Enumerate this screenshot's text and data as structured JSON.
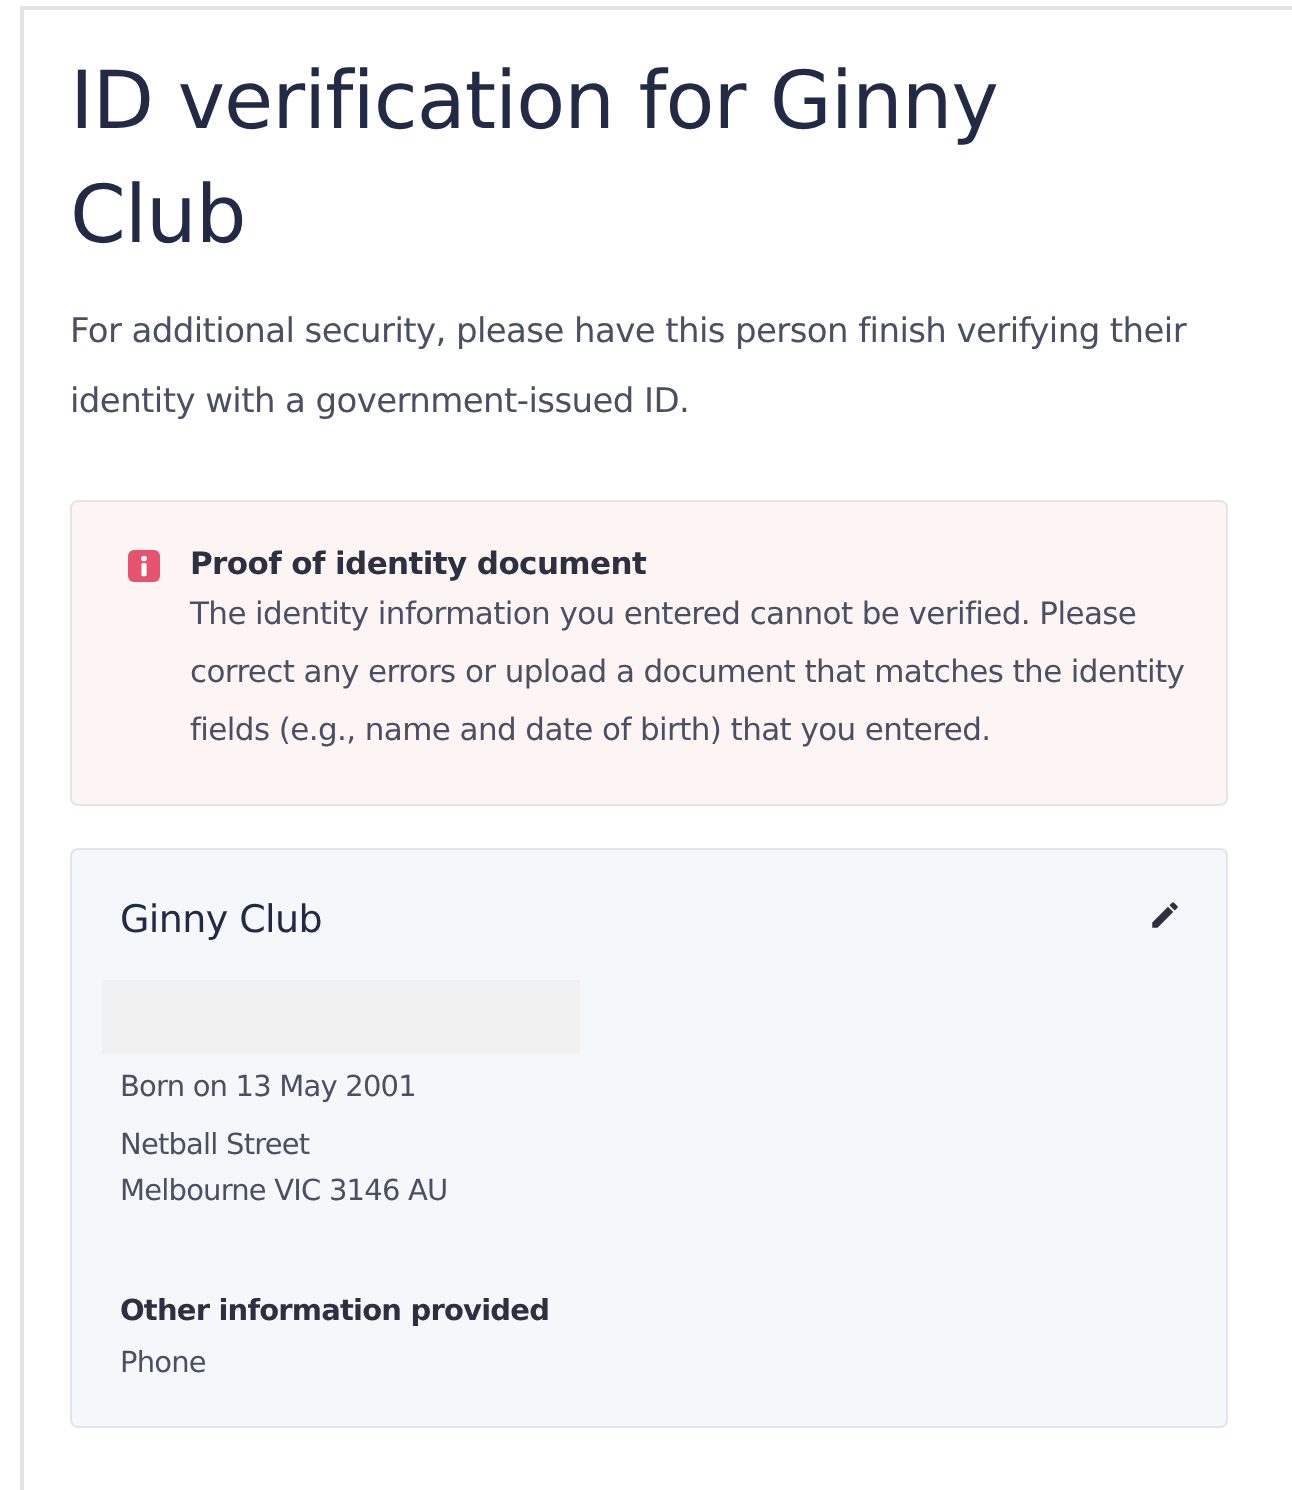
{
  "heading": {
    "title": "ID verification for Ginny Club",
    "description": "For additional security, please have this person finish verifying their identity with a government-issued ID."
  },
  "alert": {
    "kind": "error",
    "title": "Proof of identity document",
    "message": "The identity information you entered cannot be verified. Please correct any errors or upload a document that matches the identity fields (e.g., name and date of birth) that you entered."
  },
  "person": {
    "name": "Ginny Club",
    "birth": "Born on 13 May 2001",
    "address": [
      "Netball Street",
      "Melbourne VIC 3146 AU"
    ],
    "other_heading": "Other information provided",
    "other_items": [
      "Phone"
    ]
  }
}
